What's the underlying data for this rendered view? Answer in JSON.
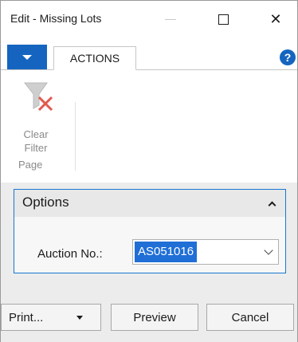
{
  "window": {
    "title": "Edit - Missing Lots"
  },
  "ribbon": {
    "tab_label": "ACTIONS",
    "clear_filter_line1": "Clear",
    "clear_filter_line2": "Filter",
    "group_label": "Page"
  },
  "options": {
    "title": "Options",
    "field_label": "Auction No.:",
    "field_value": "AS051016"
  },
  "footer": {
    "print_label": "Print...",
    "preview_label": "Preview",
    "cancel_label": "Cancel"
  },
  "colors": {
    "accent": "#1565c0",
    "selection": "#1f6fd6",
    "filter_clear_red": "#e05a4f"
  }
}
